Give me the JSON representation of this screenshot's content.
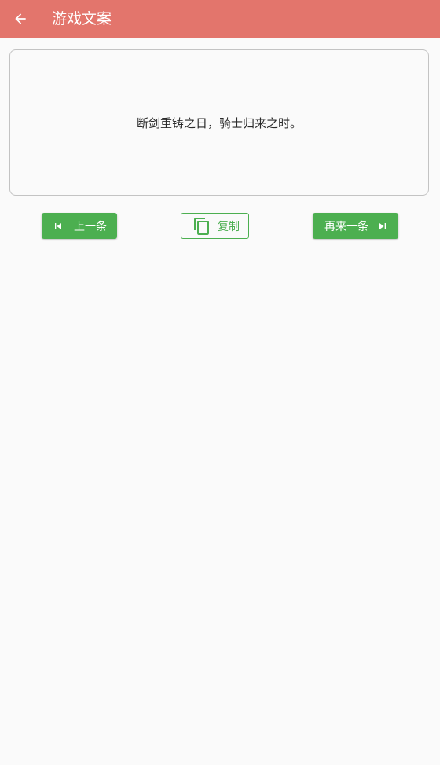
{
  "appbar": {
    "title": "游戏文案",
    "bg_color": "#e3756c",
    "back_icon": "arrow-back-icon"
  },
  "card": {
    "text": "断剑重铸之日，骑士归来之时。"
  },
  "buttons": {
    "prev": {
      "label": "上一条",
      "icon": "skip-previous-icon"
    },
    "copy": {
      "label": "复制",
      "icon": "copy-icon"
    },
    "next": {
      "label": "再来一条",
      "icon": "skip-next-icon"
    },
    "accent_color": "#4caf50"
  }
}
